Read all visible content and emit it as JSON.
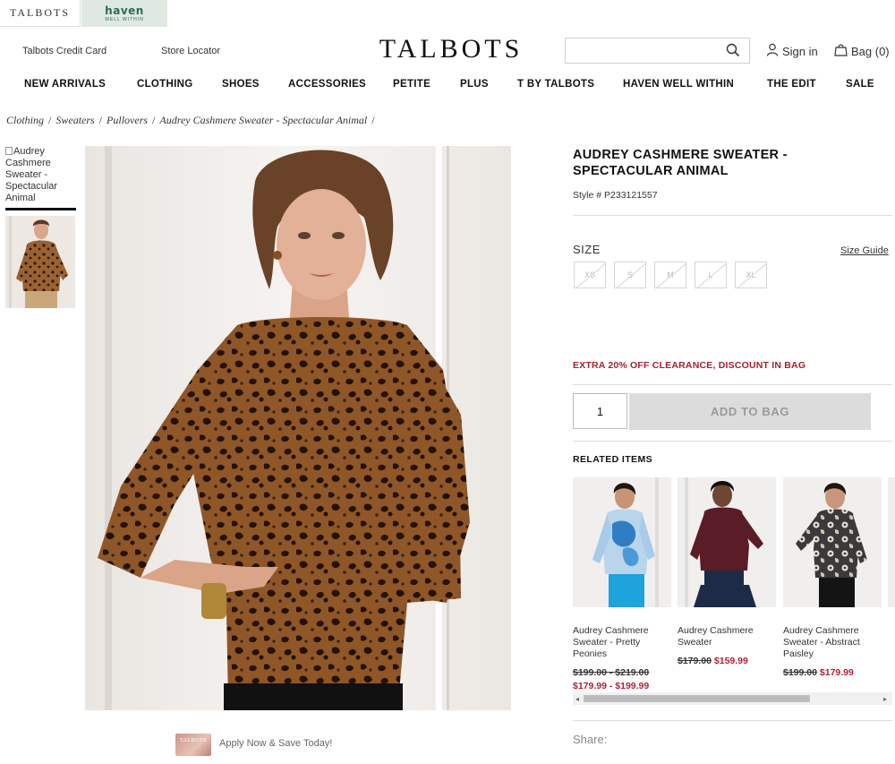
{
  "brand_tabs": {
    "talbots": "TALBOTS",
    "haven_main": "haven",
    "haven_sub": "WELL WITHIN"
  },
  "header": {
    "credit_card": "Talbots Credit Card",
    "store_locator": "Store Locator",
    "logo": "TALBOTS",
    "search_placeholder": "",
    "sign_in": "Sign in",
    "bag": "Bag (0)"
  },
  "nav": [
    "NEW ARRIVALS",
    "CLOTHING",
    "SHOES",
    "ACCESSORIES",
    "PETITE",
    "PLUS",
    "T BY TALBOTS",
    "HAVEN WELL WITHIN",
    "THE EDIT",
    "SALE"
  ],
  "breadcrumb": [
    "Clothing",
    "Sweaters",
    "Pullovers",
    "Audrey Cashmere Sweater - Spectacular Animal"
  ],
  "thumbnails": {
    "alt_text": "Audrey Cashmere Sweater - Spectacular Animal"
  },
  "product": {
    "title": "AUDREY CASHMERE SWEATER - SPECTACULAR ANIMAL",
    "style": "Style # P233121557",
    "size_label": "SIZE",
    "size_guide": "Size Guide",
    "sizes": [
      "XS",
      "S",
      "M",
      "L",
      "XL"
    ],
    "promo": "EXTRA 20% OFF CLEARANCE, DISCOUNT IN BAG",
    "quantity": "1",
    "add_to_bag": "ADD TO BAG"
  },
  "related": {
    "heading": "RELATED ITEMS",
    "items": [
      {
        "name": "Audrey Cashmere Sweater - Pretty Peonies",
        "was": "$199.00 - $219.00",
        "now": "$179.99 - $199.99"
      },
      {
        "name": "Audrey Cashmere Sweater",
        "was": "$179.00",
        "now": "$159.99"
      },
      {
        "name": "Audrey Cashmere Sweater - Abstract Paisley",
        "was": "$199.00",
        "now": "$179.99"
      }
    ]
  },
  "apply": {
    "card_text": "TALBOTS",
    "text": "Apply Now & Save Today!"
  },
  "share": "Share:",
  "colors": {
    "promo_red": "#a8202f",
    "sale_red": "#b32036",
    "haven_green": "#2e6b52",
    "haven_bg": "#dfe9e1"
  }
}
